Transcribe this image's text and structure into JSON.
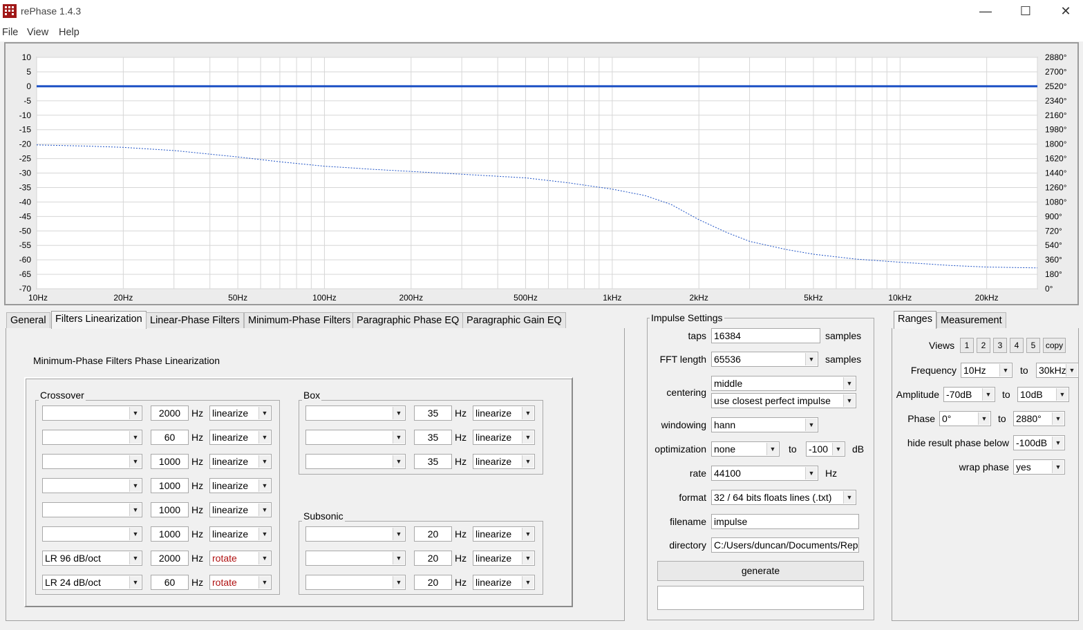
{
  "window": {
    "title": "rePhase 1.4.3",
    "minimize": "—",
    "maximize": "☐",
    "close": "✕"
  },
  "menu": [
    "File",
    "View",
    "Help"
  ],
  "chart_data": {
    "type": "line",
    "x_ticks": [
      "10Hz",
      "20Hz",
      "50Hz",
      "100Hz",
      "200Hz",
      "500Hz",
      "1kHz",
      "2kHz",
      "5kHz",
      "10kHz",
      "20kHz"
    ],
    "x_tick_values": [
      10,
      20,
      50,
      100,
      200,
      500,
      1000,
      2000,
      5000,
      10000,
      20000
    ],
    "xlim": [
      10,
      30000
    ],
    "x_scale": "log",
    "y_ticks": [
      "10",
      "5",
      "0",
      "-5",
      "-10",
      "-15",
      "-20",
      "-25",
      "-30",
      "-35",
      "-40",
      "-45",
      "-50",
      "-55",
      "-60",
      "-65",
      "-70"
    ],
    "ylim": [
      -70,
      10
    ],
    "y2_ticks": [
      "2880°",
      "2700°",
      "2520°",
      "2340°",
      "2160°",
      "1980°",
      "1800°",
      "1620°",
      "1440°",
      "1260°",
      "1080°",
      "900°",
      "720°",
      "540°",
      "360°",
      "180°",
      "0°"
    ],
    "y2lim": [
      0,
      2880
    ],
    "grid": true,
    "series": [
      {
        "kind": "amplitude",
        "axis": "left",
        "style": "solid",
        "color": "#1a4fc4",
        "x": [
          10,
          30000
        ],
        "y": [
          0,
          0
        ]
      },
      {
        "kind": "phase",
        "axis": "right",
        "style": "dotted",
        "color": "#1a4fc4",
        "x": [
          10,
          15,
          20,
          30,
          50,
          70,
          100,
          150,
          200,
          300,
          500,
          700,
          1000,
          1300,
          1600,
          2000,
          2500,
          3000,
          4000,
          5000,
          7000,
          10000,
          15000,
          20000,
          30000
        ],
        "y": [
          1790,
          1775,
          1760,
          1720,
          1640,
          1580,
          1525,
          1485,
          1460,
          1425,
          1380,
          1320,
          1240,
          1160,
          1050,
          860,
          700,
          590,
          490,
          430,
          370,
          330,
          290,
          270,
          260
        ]
      }
    ]
  },
  "tabs": [
    "General",
    "Filters Linearization",
    "Linear-Phase Filters",
    "Minimum-Phase Filters",
    "Paragraphic Phase EQ",
    "Paragraphic Gain EQ"
  ],
  "linearization": {
    "title": "Minimum-Phase Filters Phase Linearization",
    "crossover": {
      "legend": "Crossover",
      "rows": [
        {
          "type": "",
          "freq": "2000",
          "unit": "Hz",
          "mode": "linearize",
          "mode_red": false
        },
        {
          "type": "",
          "freq": "60",
          "unit": "Hz",
          "mode": "linearize",
          "mode_red": false
        },
        {
          "type": "",
          "freq": "1000",
          "unit": "Hz",
          "mode": "linearize",
          "mode_red": false
        },
        {
          "type": "",
          "freq": "1000",
          "unit": "Hz",
          "mode": "linearize",
          "mode_red": false
        },
        {
          "type": "",
          "freq": "1000",
          "unit": "Hz",
          "mode": "linearize",
          "mode_red": false
        },
        {
          "type": "",
          "freq": "1000",
          "unit": "Hz",
          "mode": "linearize",
          "mode_red": false
        },
        {
          "type": "LR  96 dB/oct",
          "freq": "2000",
          "unit": "Hz",
          "mode": "rotate",
          "mode_red": true
        },
        {
          "type": "LR  24 dB/oct",
          "freq": "60",
          "unit": "Hz",
          "mode": "rotate",
          "mode_red": true
        }
      ]
    },
    "box": {
      "legend": "Box",
      "rows": [
        {
          "type": "",
          "freq": "35",
          "unit": "Hz",
          "mode": "linearize"
        },
        {
          "type": "",
          "freq": "35",
          "unit": "Hz",
          "mode": "linearize"
        },
        {
          "type": "",
          "freq": "35",
          "unit": "Hz",
          "mode": "linearize"
        }
      ]
    },
    "subsonic": {
      "legend": "Subsonic",
      "rows": [
        {
          "type": "",
          "freq": "20",
          "unit": "Hz",
          "mode": "linearize"
        },
        {
          "type": "",
          "freq": "20",
          "unit": "Hz",
          "mode": "linearize"
        },
        {
          "type": "",
          "freq": "20",
          "unit": "Hz",
          "mode": "linearize"
        }
      ]
    }
  },
  "impulse": {
    "legend": "Impulse Settings",
    "taps_label": "taps",
    "taps": "16384",
    "taps_unit": "samples",
    "fft_label": "FFT length",
    "fft": "65536",
    "fft_unit": "samples",
    "centering_label": "centering",
    "centering": "middle",
    "centering2": "use closest perfect impulse",
    "windowing_label": "windowing",
    "windowing": "hann",
    "optimization_label": "optimization",
    "optimization": "none",
    "opt_to": "to",
    "opt_db": "-100",
    "opt_unit": "dB",
    "rate_label": "rate",
    "rate": "44100",
    "rate_unit": "Hz",
    "format_label": "format",
    "format": "32 / 64 bits floats lines (.txt)",
    "filename_label": "filename",
    "filename": "impulse",
    "directory_label": "directory",
    "directory": "C:/Users/duncan/Documents/Rep",
    "generate": "generate",
    "status": ""
  },
  "ranges": {
    "tabs": [
      "Ranges",
      "Measurement"
    ],
    "views_label": "Views",
    "views": [
      "1",
      "2",
      "3",
      "4",
      "5"
    ],
    "copy": "copy",
    "frequency_label": "Frequency",
    "freq_from": "10Hz",
    "freq_to": "30kHz",
    "amplitude_label": "Amplitude",
    "amp_from": "-70dB",
    "amp_to": "10dB",
    "phase_label": "Phase",
    "phase_from": "0°",
    "phase_to": "2880°",
    "to": "to",
    "hide_label": "hide result phase below",
    "hide": "-100dB",
    "wrap_label": "wrap phase",
    "wrap": "yes"
  }
}
